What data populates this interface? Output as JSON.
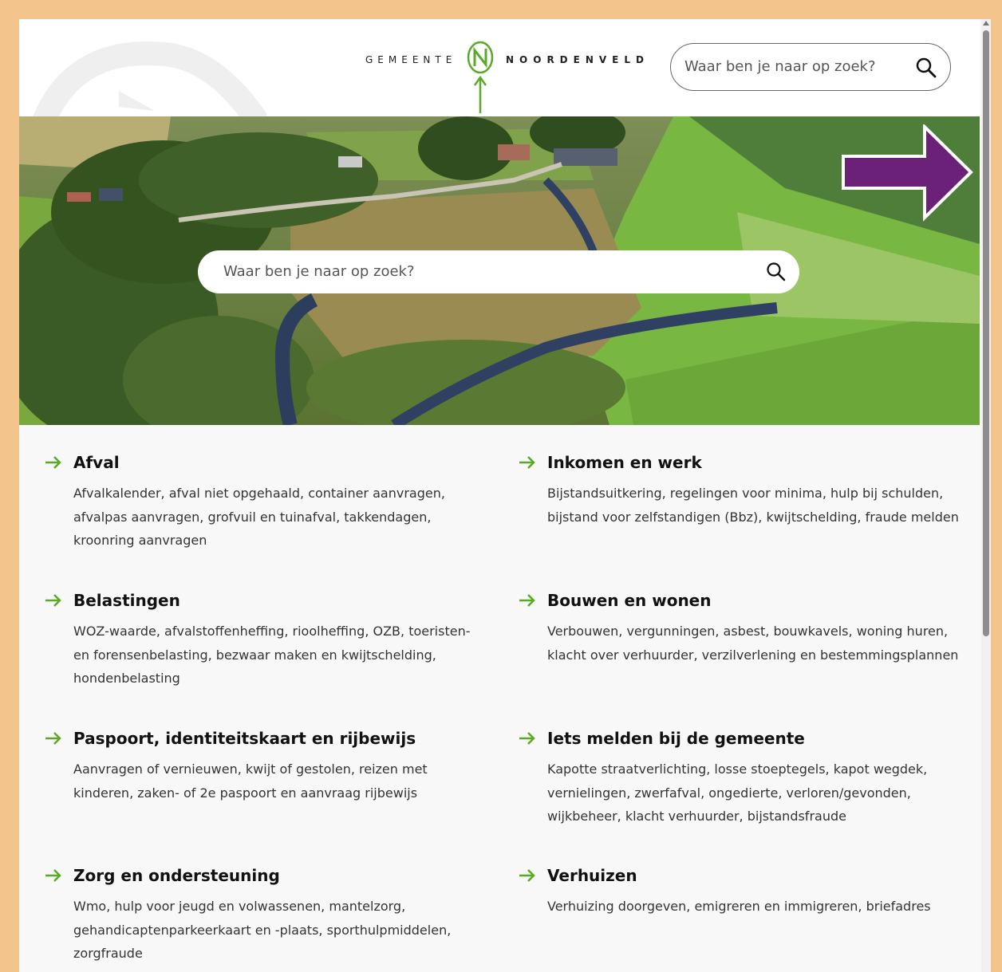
{
  "header": {
    "logo_left": "GEMEENTE",
    "logo_right": "NOORDENVELD",
    "search_placeholder": "Waar ben je naar op zoek?"
  },
  "hero": {
    "search_placeholder": "Waar ben je naar op zoek?"
  },
  "colors": {
    "accent_green": "#5aaa28",
    "annotation_arrow": "#6b2177",
    "frame": "#f3c48c"
  },
  "categories": [
    {
      "title": "Afval",
      "text": "Afvalkalender, afval niet opgehaald, container aanvragen, afvalpas aanvragen, grofvuil en tuinafval, takkendagen, kroonring aanvragen"
    },
    {
      "title": "Inkomen en werk",
      "text": "Bijstandsuitkering, regelingen voor minima, hulp bij schulden, bijstand voor zelfstandigen (Bbz), kwijtschelding, fraude melden"
    },
    {
      "title": "Belastingen",
      "text": "WOZ-waarde, afvalstoffenheffing, rioolheffing, OZB, toeristen- en forensenbelasting, bezwaar maken en kwijtschelding, hondenbelasting"
    },
    {
      "title": "Bouwen en wonen",
      "text": "Verbouwen, vergunningen, asbest, bouwkavels, woning huren, klacht over verhuurder, verzilverlening en bestemmingsplannen"
    },
    {
      "title": "Paspoort, identiteitskaart en rijbewijs",
      "text": "Aanvragen of vernieuwen, kwijt of gestolen, reizen met kinderen, zaken- of 2e paspoort en aanvraag rijbewijs"
    },
    {
      "title": "Iets melden bij de gemeente",
      "text": "Kapotte straatverlichting, losse stoeptegels, kapot wegdek, vernielingen, zwerfafval, ongedierte, verloren/gevonden, wijkbeheer, klacht verhuurder, bijstandsfraude"
    },
    {
      "title": "Zorg en ondersteuning",
      "text": "Wmo, hulp voor jeugd en volwassenen, mantelzorg, gehandicaptenparkeerkaart en -plaats, sporthulpmiddelen, zorgfraude"
    },
    {
      "title": "Verhuizen",
      "text": "Verhuizing doorgeven, emigreren en immigreren, briefadres"
    }
  ]
}
